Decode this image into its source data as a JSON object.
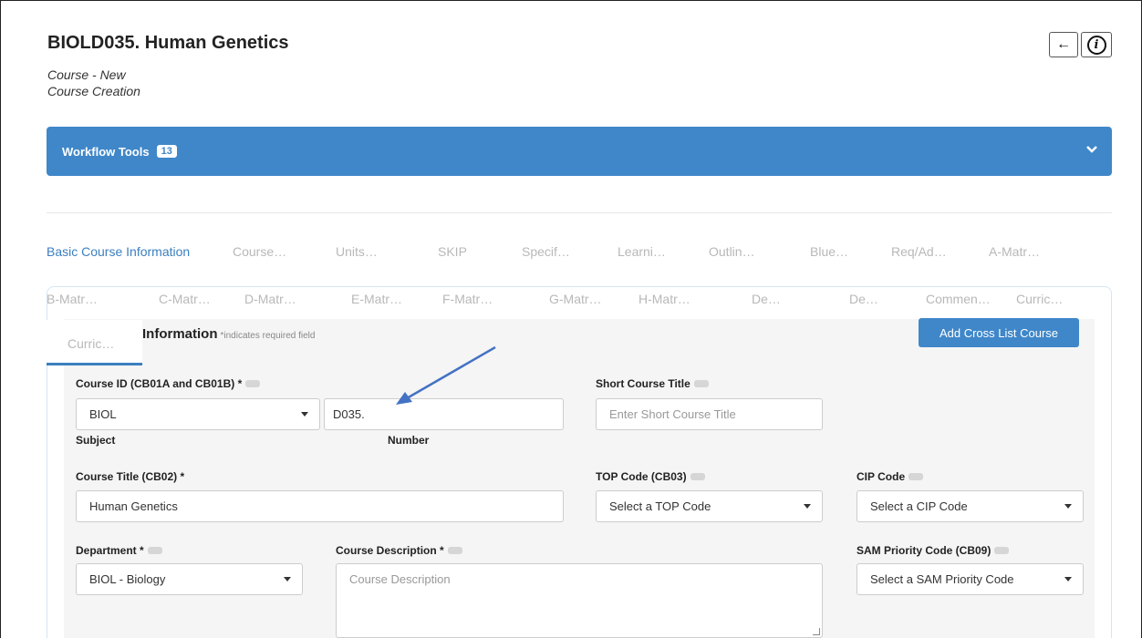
{
  "header": {
    "title": "BIOLD035. Human Genetics",
    "subtitle1": "Course - New",
    "subtitle2": "Course Creation",
    "back_icon": "←",
    "info_icon": "i"
  },
  "workflow": {
    "label": "Workflow Tools",
    "badge": "13",
    "chevron": "⌄"
  },
  "tabs_row1": [
    "Basic Course Information",
    "Course…",
    "Units…",
    "SKIP",
    "Specif…",
    "Learni…",
    "Outlin…",
    "Blue…",
    "Req/Ad…",
    "A-Matr…"
  ],
  "tabs_row2": [
    "B-Matr…",
    "C-Matr…",
    "D-Matr…",
    "E-Matr…",
    "F-Matr…",
    "G-Matr…",
    "H-Matr…",
    "De…",
    "De…",
    "Commen…",
    "Curric…"
  ],
  "tabs_row3": [
    "Curric…"
  ],
  "section": {
    "title": "Information",
    "note": "*indicates required field",
    "add_button": "Add Cross List Course"
  },
  "form": {
    "course_id_label": "Course ID (CB01A and CB01B) *",
    "subject_value": "BIOL",
    "number_value": "D035.",
    "subject_label": "Subject",
    "number_label": "Number",
    "short_title_label": "Short Course Title",
    "short_title_placeholder": "Enter Short Course Title",
    "course_title_label": "Course Title (CB02) *",
    "course_title_value": "Human Genetics",
    "top_code_label": "TOP Code (CB03)",
    "top_code_value": "Select a TOP Code",
    "cip_label": "CIP Code",
    "cip_value": "Select a CIP Code",
    "department_label": "Department *",
    "department_value": "BIOL - Biology",
    "description_label": "Course Description *",
    "description_placeholder": "Course Description",
    "sam_label": "SAM Priority Code (CB09)",
    "sam_value": "Select a SAM Priority Code"
  },
  "colors": {
    "accent": "#3f87c9",
    "active_tab": "#3c7fbf",
    "annotation_arrow": "#4472c4"
  }
}
